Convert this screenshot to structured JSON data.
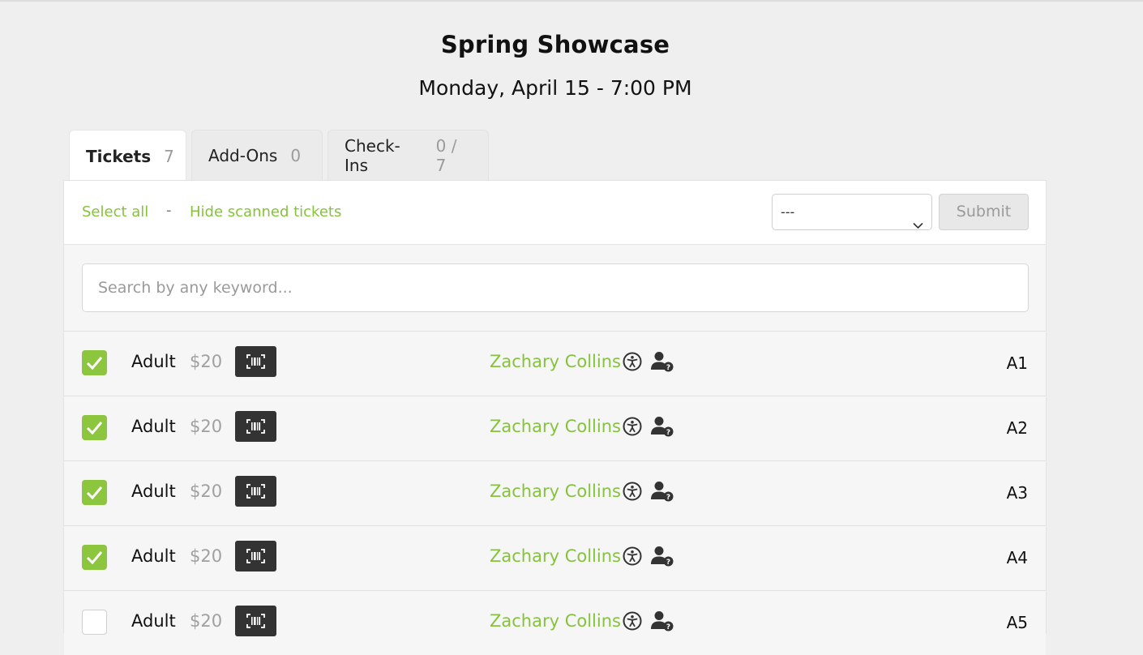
{
  "event": {
    "title": "Spring Showcase",
    "date": "Monday, April 15 - 7:00 PM"
  },
  "tabs": [
    {
      "label": "Tickets",
      "count": "7",
      "active": true
    },
    {
      "label": "Add-Ons",
      "count": "0",
      "active": false
    },
    {
      "label": "Check-Ins",
      "count": "0 / 7",
      "active": false
    }
  ],
  "toolbar": {
    "select_all": "Select all",
    "separator": "-",
    "hide_scanned": "Hide scanned tickets",
    "select_value": "---",
    "submit_label": "Submit"
  },
  "search": {
    "placeholder": "Search by any keyword..."
  },
  "tickets": [
    {
      "checked": true,
      "type": "Adult",
      "price": "$20",
      "holder": "Zachary Collins",
      "seat": "A1"
    },
    {
      "checked": true,
      "type": "Adult",
      "price": "$20",
      "holder": "Zachary Collins",
      "seat": "A2"
    },
    {
      "checked": true,
      "type": "Adult",
      "price": "$20",
      "holder": "Zachary Collins",
      "seat": "A3"
    },
    {
      "checked": true,
      "type": "Adult",
      "price": "$20",
      "holder": "Zachary Collins",
      "seat": "A4"
    },
    {
      "checked": false,
      "type": "Adult",
      "price": "$20",
      "holder": "Zachary Collins",
      "seat": "A5"
    }
  ],
  "icons": {
    "scan": "barcode-scan-icon",
    "accessibility": "accessibility-icon",
    "user": "user-question-icon",
    "check": "checkmark-icon",
    "dropdown": "chevron-down-icon"
  },
  "colors": {
    "accent": "#86c23d",
    "checkbox": "#8cc63f",
    "dark_button": "#333333",
    "muted": "#9b9b9b"
  }
}
